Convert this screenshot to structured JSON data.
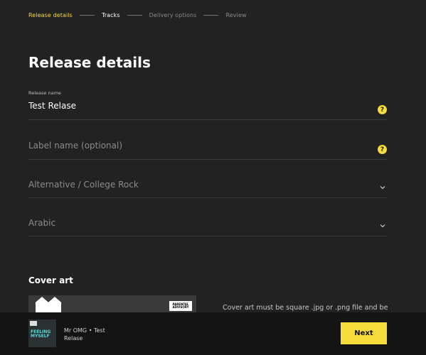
{
  "stepper": {
    "steps": [
      {
        "label": "Release details",
        "state": "active"
      },
      {
        "label": "Tracks",
        "state": "next"
      },
      {
        "label": "Delivery options",
        "state": "muted"
      },
      {
        "label": "Review",
        "state": "muted"
      }
    ]
  },
  "page": {
    "title": "Release details"
  },
  "fields": {
    "release_name": {
      "label": "Release name",
      "value": "Test Relase",
      "help_icon": "question-icon"
    },
    "label_name": {
      "placeholder": "Label name (optional)",
      "help_icon": "question-icon"
    },
    "genre": {
      "value": "Alternative / College Rock",
      "icon": "chevron-down-icon"
    },
    "language": {
      "value": "Arabic",
      "icon": "chevron-down-icon"
    }
  },
  "cover_art": {
    "title": "Cover art",
    "note": "Cover art must be square .jpg or .png file and be",
    "advisory_text": [
      "PARENTAL",
      "ADVISORY"
    ]
  },
  "bottom_bar": {
    "thumb_text": "FEELING MYSELF",
    "artist": "Mr OMG",
    "separator": "•",
    "release": "Test",
    "release_line2": "Relase",
    "next_label": "Next"
  },
  "colors": {
    "accent": "#f5dc3a",
    "background": "#222222",
    "bottom_bar": "#141414"
  }
}
